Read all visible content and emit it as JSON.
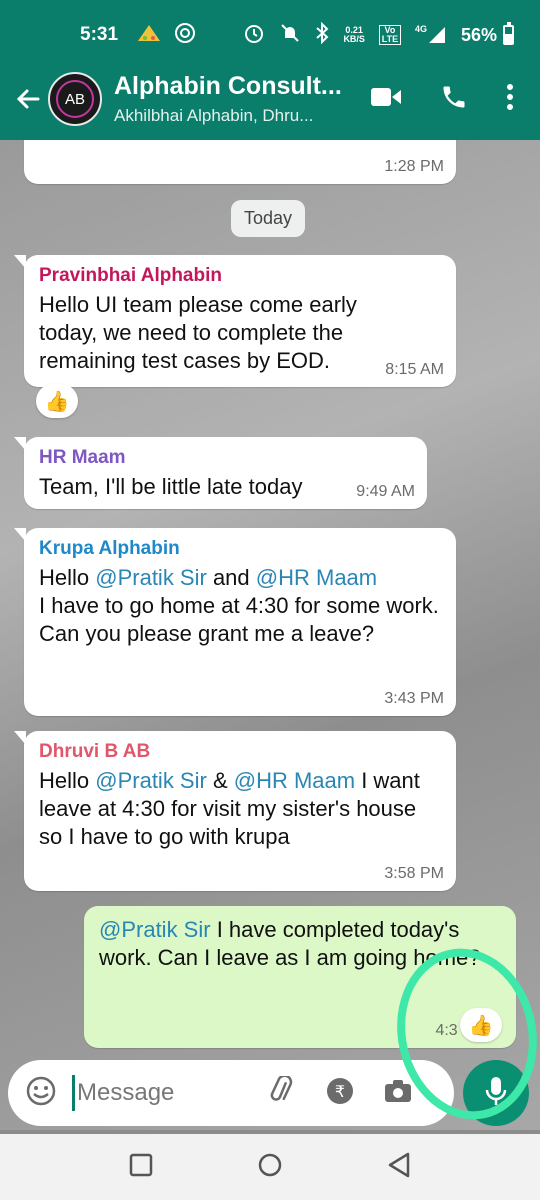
{
  "status_bar": {
    "time": "5:31",
    "net_speed_value": "0.21",
    "net_speed_unit": "KB/S",
    "volte": "Vo LTE",
    "signal_label": "4G",
    "battery": "56%"
  },
  "header": {
    "title": "Alphabin Consult...",
    "subtitle": "Akhilbhai Alphabin, Dhru...",
    "avatar_text": "AB"
  },
  "chat": {
    "partial_message_time": "1:28 PM",
    "date_chip": "Today",
    "messages": [
      {
        "sender": "Pravinbhai Alphabin",
        "sender_color": "#c2185b",
        "text": "Hello UI team please come early today, we need to complete the remaining test cases by EOD.",
        "time": "8:15 AM",
        "reaction": "👍"
      },
      {
        "sender": "HR Maam",
        "sender_color": "#7e57c2",
        "text": "Team, I'll be little late today",
        "time": "9:49 AM"
      },
      {
        "sender": "Krupa Alphabin",
        "sender_color": "#1e88c9",
        "text_parts": [
          "Hello ",
          "@Pratik Sir",
          " and ",
          "@HR Maam",
          "I have to go home at 4:30 for some work.",
          "Can you please grant me a leave?"
        ],
        "time": "3:43 PM"
      },
      {
        "sender": "Dhruvi B AB",
        "sender_color": "#e0566b",
        "text_parts": [
          "Hello ",
          "@Pratik Sir",
          " & ",
          "@HR Maam",
          " I want leave at 4:30 for visit my sister's house so I have to go with krupa"
        ],
        "time": "3:58 PM"
      },
      {
        "sender": "",
        "text_parts": [
          "@Pratik Sir",
          " I have completed today's work. Can I leave as I am going home?"
        ],
        "time": "4:3 PM",
        "status": "✓",
        "reaction": "👍"
      }
    ]
  },
  "composer": {
    "placeholder": "Message"
  },
  "colors": {
    "header_bg": "#0a7d6b",
    "outgoing_bubble": "#dcf8c6",
    "highlight_ring": "#3ee8a8"
  }
}
